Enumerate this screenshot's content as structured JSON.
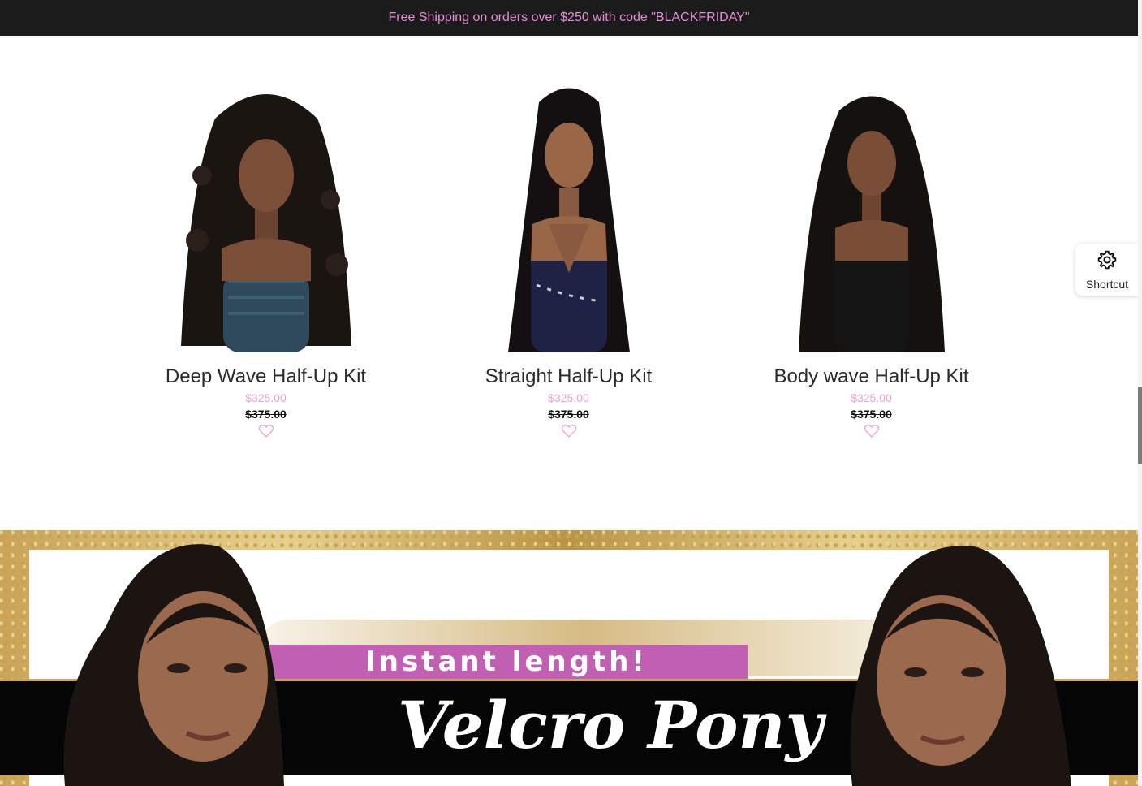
{
  "announcement": {
    "text": "Free Shipping on orders over $250 with code \"BLACKFRIDAY\""
  },
  "products": [
    {
      "name": "Deep Wave Half-Up Kit",
      "sale_price": "$325.00",
      "original_price": "$375.00",
      "outfit_color": "#2f4a5a",
      "wishlist_icon": "heart-outline-icon"
    },
    {
      "name": "Straight Half-Up Kit",
      "sale_price": "$325.00",
      "original_price": "$375.00",
      "outfit_color": "#1e2245",
      "wishlist_icon": "heart-outline-icon"
    },
    {
      "name": "Body wave Half-Up Kit",
      "sale_price": "$325.00",
      "original_price": "$375.00",
      "outfit_color": "#141414",
      "wishlist_icon": "heart-outline-icon"
    }
  ],
  "shortcut": {
    "label": "Shortcut",
    "icon": "gear-icon"
  },
  "banner": {
    "tagline": "Instant length!",
    "headline": "Velcro Pony"
  },
  "colors": {
    "accent_pink": "#e8a2d6",
    "announce_text": "#e58fd8",
    "announce_bg": "#1c1b1b",
    "banner_pink": "#c15fb2"
  }
}
